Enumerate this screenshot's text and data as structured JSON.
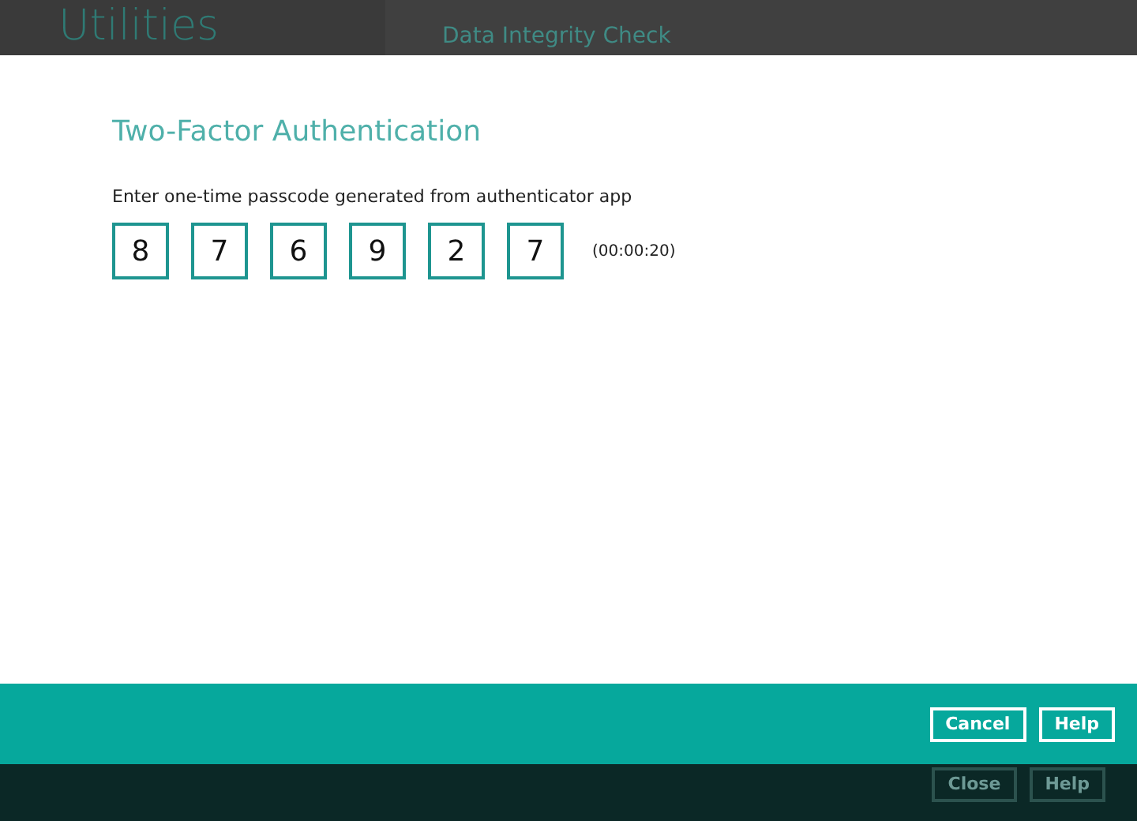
{
  "background": {
    "title": "Utilities",
    "subtitle": "Data Integrity Check"
  },
  "dialog": {
    "title": "Two-Factor Authentication",
    "prompt": "Enter one-time passcode generated from authenticator app",
    "digits": [
      "8",
      "7",
      "6",
      "9",
      "2",
      "7"
    ],
    "timer": "(00:00:20)"
  },
  "buttons": [
    {
      "label": "Cancel",
      "disabled": false
    },
    {
      "label": "Help",
      "disabled": false
    }
  ],
  "background_buttons": [
    {
      "label": "Close",
      "disabled": true
    },
    {
      "label": "Help",
      "disabled": true
    }
  ]
}
